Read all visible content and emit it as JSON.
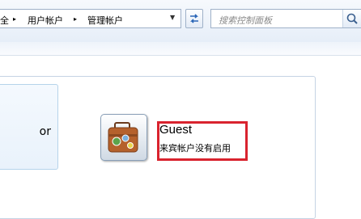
{
  "address_bar": {
    "breadcrumbs": [
      "全",
      "用户帐户",
      "管理帐户"
    ],
    "separator": "▸",
    "dropdown_glyph": "▼"
  },
  "search": {
    "placeholder": "搜索控制面板"
  },
  "accounts": [
    {
      "name_fragment": "or"
    },
    {
      "name": "Guest",
      "status": "来宾帐户没有启用",
      "highlighted": true,
      "highlight_color": "#d9232e"
    }
  ]
}
